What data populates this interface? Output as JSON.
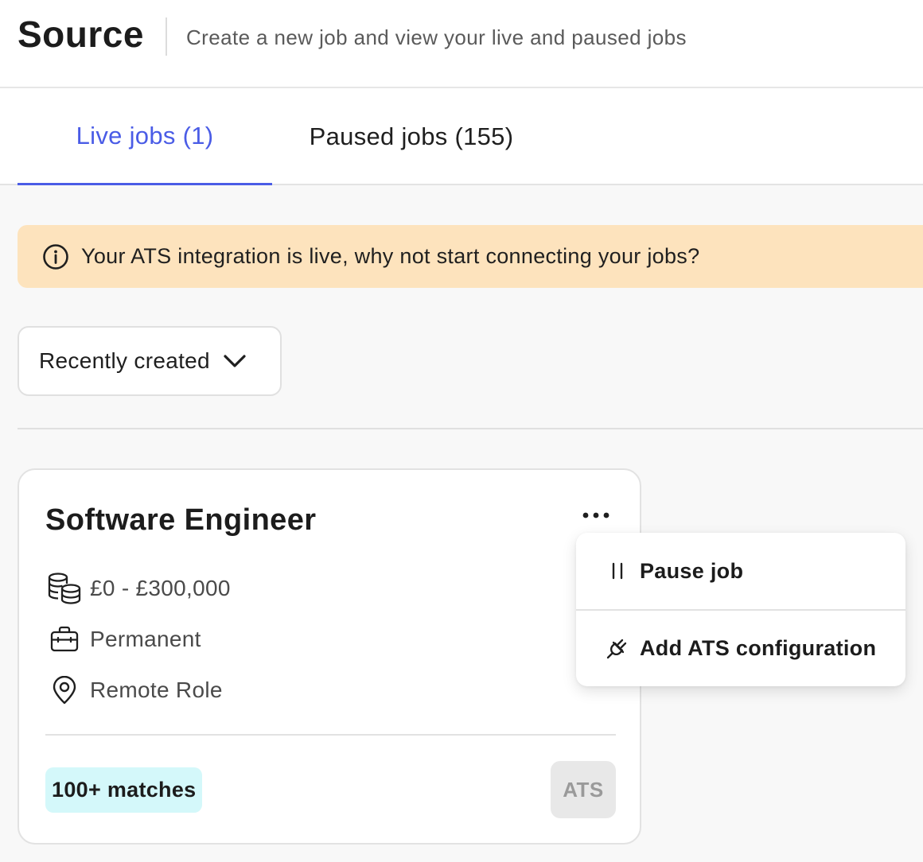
{
  "header": {
    "title": "Source",
    "subtitle": "Create a new job and view your live and paused jobs"
  },
  "tabs": [
    {
      "label": "Live jobs (1)",
      "active": true
    },
    {
      "label": "Paused jobs (155)",
      "active": false
    }
  ],
  "banner": {
    "icon": "info-icon",
    "text": "Your ATS integration is live, why not start connecting your jobs?",
    "background": "#fde3bd"
  },
  "sort": {
    "selected": "Recently created",
    "icon": "chevron-down-icon"
  },
  "job_card": {
    "title": "Software Engineer",
    "salary": "£0 - £300,000",
    "employment_type": "Permanent",
    "location": "Remote Role",
    "matches": "100+ matches",
    "ats_badge": "ATS",
    "menu_icon": "more-horizontal-icon"
  },
  "card_menu": {
    "items": [
      {
        "label": "Pause job",
        "icon": "pause-icon"
      },
      {
        "label": "Add ATS configuration",
        "icon": "plug-icon"
      }
    ]
  },
  "colors": {
    "accent": "#4a5ce6",
    "matches_badge": "#d4f8fa",
    "ats_badge_bg": "#e8e8e8",
    "page_bg": "#f8f8f8"
  }
}
